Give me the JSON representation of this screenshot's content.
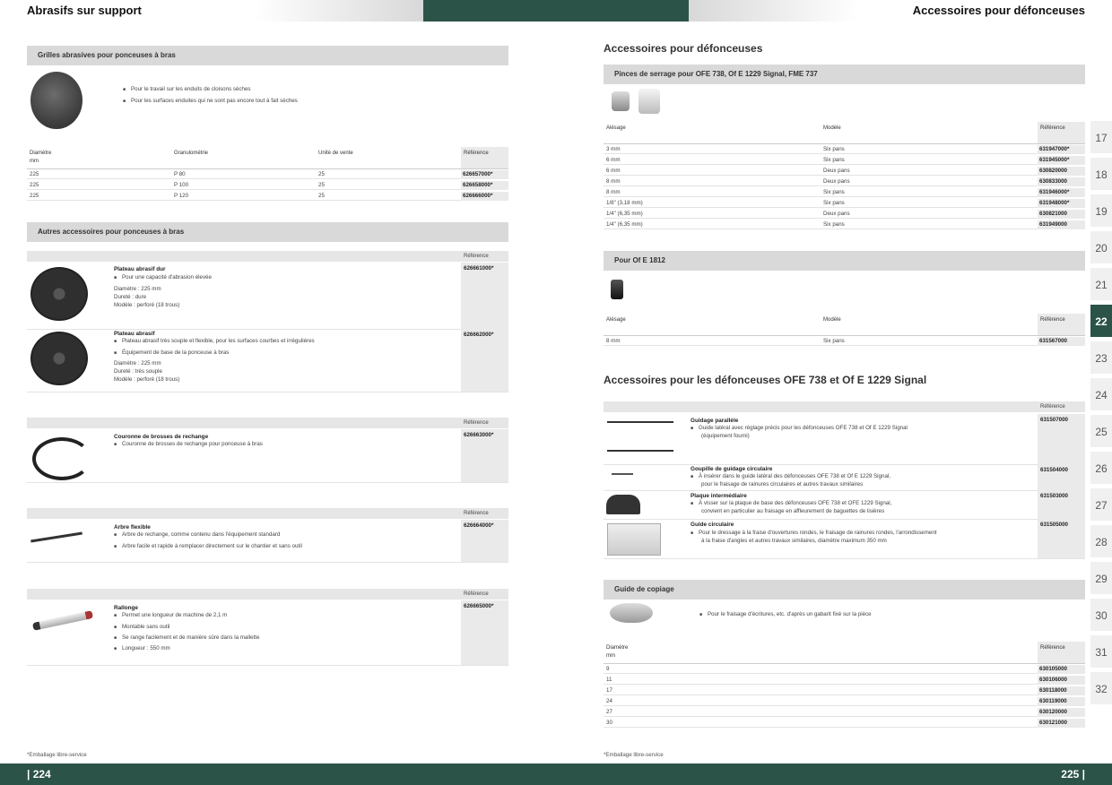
{
  "header": {
    "left_title": "Abrasifs sur support",
    "right_title": "Accessoires pour défonceuses"
  },
  "left": {
    "section1": {
      "title": "Grilles abrasives pour ponceuses à bras",
      "bullets": [
        "Pour le travail sur les enduits de cloisons sèches",
        "Pour les surfaces enduites qui ne sont pas encore tout à fait sèches"
      ],
      "headers": {
        "diam": "Diamètre",
        "mm": "mm",
        "grain": "Granulométrie",
        "unit": "Unité de vente",
        "ref": "Référence"
      },
      "rows": [
        {
          "d": "225",
          "g": "P 80",
          "u": "25",
          "r": "626657000*"
        },
        {
          "d": "225",
          "g": "P 100",
          "u": "25",
          "r": "626658000*"
        },
        {
          "d": "225",
          "g": "P 120",
          "u": "25",
          "r": "626666000*"
        }
      ]
    },
    "section2": {
      "title": "Autres accessoires pour ponceuses à bras"
    },
    "ref_label": "Référence",
    "item1": {
      "title": "Plateau abrasif dur",
      "bullets": [
        "Pour une capacité d'abrasion élevée"
      ],
      "lines": [
        "Diamètre : 225 mm",
        "Dureté : dure",
        "Modèle : perforé (18 trous)"
      ],
      "ref": "626661000*"
    },
    "item2": {
      "title": "Plateau abrasif",
      "bullets": [
        "Plateau abrasif très souple et flexible, pour les surfaces courbes et irrégulières",
        "Équipement de base de la ponceuse à bras"
      ],
      "lines": [
        "Diamètre : 225 mm",
        "Dureté : très souple",
        "Modèle : perforé (18 trous)"
      ],
      "ref": "626662000*"
    },
    "item3": {
      "title": "Couronne de brosses de rechange",
      "bullets": [
        "Couronne de brosses de rechange pour ponceuse à bras"
      ],
      "ref": "626663000*"
    },
    "item4": {
      "title": "Arbre flexible",
      "bullets": [
        "Arbre de rechange, comme contenu dans l'équipement standard",
        "Arbre facile et rapide à remplacer directement sur le chantier et sans outil"
      ],
      "ref": "626664000*"
    },
    "item5": {
      "title": "Rallonge",
      "bullets": [
        "Permet une longueur de machine de 2,1 m",
        "Montable sans outil",
        "Se range facilement et de manière sûre dans la mallette",
        "Longueur : 550 mm"
      ],
      "ref": "626665000*"
    },
    "footnote": "*Emballage libre-service",
    "page_no": "| 224"
  },
  "right": {
    "h1": "Accessoires pour défonceuses",
    "sec1": {
      "title": "Pinces de serrage pour OFE 738, Of E 1229 Signal, FME 737",
      "headers": {
        "a": "Alésage",
        "m": "Modèle",
        "r": "Référence"
      },
      "rows": [
        {
          "a": "3 mm",
          "m": "Six pans",
          "r": "631947000*"
        },
        {
          "a": "6 mm",
          "m": "Six pans",
          "r": "631945000*"
        },
        {
          "a": "6 mm",
          "m": "Deux pans",
          "r": "630820000"
        },
        {
          "a": "8 mm",
          "m": "Deux pans",
          "r": "630833000"
        },
        {
          "a": "8 mm",
          "m": "Six pans",
          "r": "631946000*"
        },
        {
          "a": "1/8\" (3,18 mm)",
          "m": "Six pans",
          "r": "631948000*"
        },
        {
          "a": "1/4\" (6,35 mm)",
          "m": "Deux pans",
          "r": "630821000"
        },
        {
          "a": "1/4\" (6,35 mm)",
          "m": "Six pans",
          "r": "631949000"
        }
      ]
    },
    "sec2": {
      "title": "Pour Of E 1812",
      "headers": {
        "a": "Alésage",
        "m": "Modèle",
        "r": "Référence"
      },
      "rows": [
        {
          "a": "8 mm",
          "m": "Six pans",
          "r": "631567000"
        }
      ]
    },
    "h2": "Accessoires pour les défonceuses OFE 738 et Of E 1229 Signal",
    "ref_label": "Référence",
    "acc": [
      {
        "title": "Guidage parallèle",
        "lines": [
          "Guide latéral avec réglage précis pour les défonceuses OFE 738 et Of E 1229 Signal",
          "(équipement fourni)"
        ],
        "ref": "631507000"
      },
      {
        "title": "Goupille de guidage circulaire",
        "lines": [
          "À insérer dans le guide latéral des défonceuses OFE 738 et Of E 1229 Signal,",
          "pour le fraisage de rainures circulaires et autres travaux similaires"
        ],
        "ref": "631504000"
      },
      {
        "title": "Plaque intermédiaire",
        "lines": [
          "À visser sur la plaque de base des défonceuses OFE 738 et OFE 1229 Signal,",
          "convient en particulier au fraisage en affleurement de baguettes de lisières"
        ],
        "ref": "631503000"
      },
      {
        "title": "Guide circulaire",
        "lines": [
          "Pour le dressage à la fraise d'ouvertures rondes, le fraisage de rainures rondes, l'arrondissement",
          "à la fraise d'angles et autres travaux similaires, diamètre maximum 350 mm"
        ],
        "ref": "631505000"
      }
    ],
    "sec3": {
      "title": "Guide de copiage",
      "bullet": "Pour le fraisage d'écritures, etc. d'après un gabarit fixé sur la pièce",
      "headers": {
        "d": "Diamètre",
        "mm": "mm",
        "r": "Référence"
      },
      "rows": [
        {
          "d": "9",
          "r": "630105000"
        },
        {
          "d": "11",
          "r": "630106000"
        },
        {
          "d": "17",
          "r": "630118000"
        },
        {
          "d": "24",
          "r": "630119000"
        },
        {
          "d": "27",
          "r": "630120000"
        },
        {
          "d": "30",
          "r": "630121000"
        }
      ]
    },
    "footnote": "*Emballage libre-service",
    "page_no": "225 |"
  },
  "tabs": [
    "17",
    "18",
    "19",
    "20",
    "21",
    "22",
    "23",
    "24",
    "25",
    "26",
    "27",
    "28",
    "29",
    "30",
    "31",
    "32"
  ],
  "active_tab": "22",
  "colors": {
    "accent": "#2b5348",
    "bar": "#d9d9d9"
  }
}
